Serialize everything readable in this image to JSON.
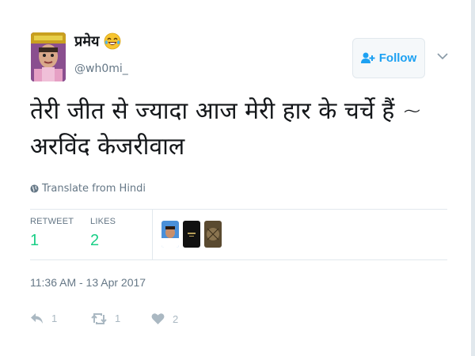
{
  "user": {
    "display_name": "प्रमेय",
    "emoji_icon": "tears-of-joy-emoji",
    "handle": "@wh0mi_",
    "avatar_icon": "profile-avatar"
  },
  "follow_button": {
    "label": "Follow",
    "icon": "add-user-icon",
    "color": "#1da1f2"
  },
  "menu_caret_icon": "chevron-down-icon",
  "tweet": {
    "text": "तेरी जीत से ज्यादा आज मेरी हार के चर्चे हैं ~ अरविंद केजरीवाल",
    "translate_label": "Translate from Hindi",
    "translate_icon": "globe-icon"
  },
  "stats": {
    "retweets_label": "RETWEET",
    "retweets_count": "1",
    "likes_label": "LIKES",
    "likes_count": "2",
    "count_color": "#19cf86",
    "likers": [
      "liker-avatar-1",
      "liker-avatar-2",
      "liker-avatar-3"
    ]
  },
  "timestamp": "11:36 AM - 13 Apr 2017",
  "actions": {
    "reply_count": "1",
    "retweet_count": "1",
    "like_count": "2",
    "reply_icon": "reply-icon",
    "retweet_icon": "retweet-icon",
    "like_icon": "heart-icon"
  }
}
